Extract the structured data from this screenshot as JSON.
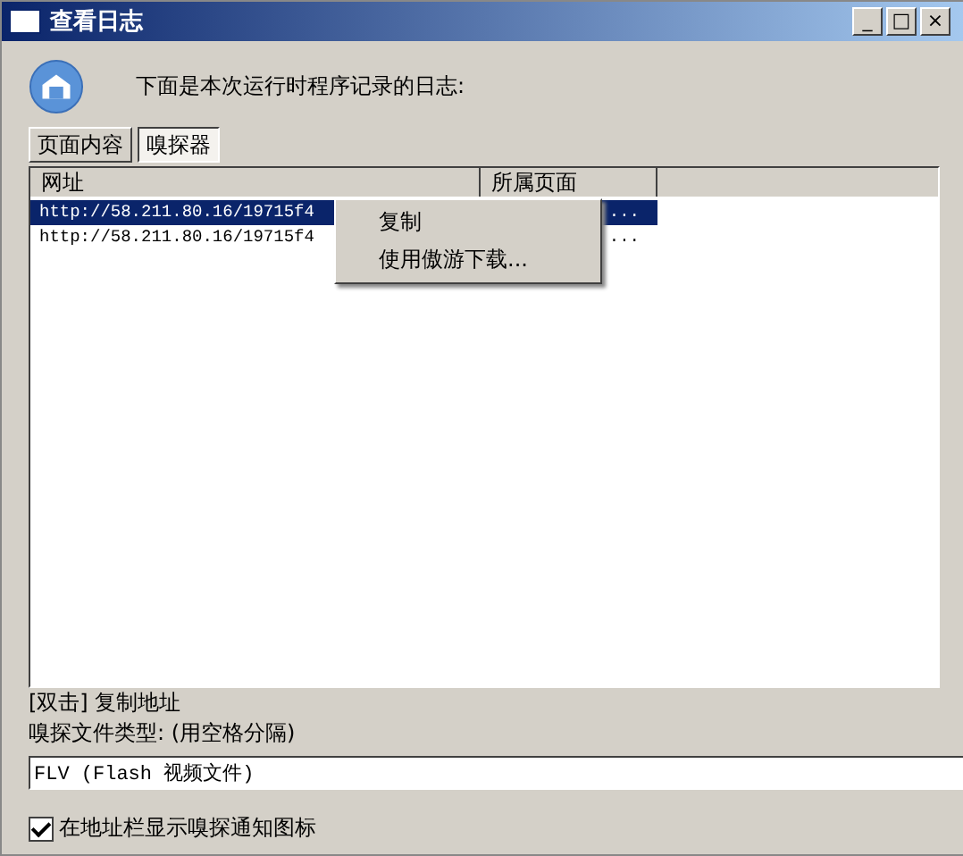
{
  "window": {
    "title": "查看日志"
  },
  "title_buttons": [
    "_",
    "□",
    "×"
  ],
  "intro": "下面是本次运行时程序记录的日志:",
  "tabs": [
    {
      "label": "页面内容",
      "selected": false
    },
    {
      "label": "嗅探器",
      "selected": true
    }
  ],
  "table": {
    "columns": [
      "网址",
      "所属页面"
    ],
    "rows": [
      {
        "url": "http://58.211.80.16/19715f4",
        "page": "...",
        "selected": true
      },
      {
        "url": "http://58.211.80.16/19715f4",
        "page": "...",
        "selected": false
      }
    ]
  },
  "context_menu": {
    "items": [
      "复制",
      "使用傲游下载..."
    ]
  },
  "hint": "[双击] 复制地址",
  "types_label": "嗅探文件类型: (用空格分隔)",
  "types_field": {
    "value": "FLV (Flash 视频文件)"
  },
  "notify_checkbox": {
    "label": "在地址栏显示嗅探通知图标",
    "checked": true
  }
}
